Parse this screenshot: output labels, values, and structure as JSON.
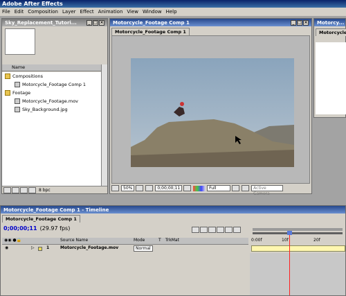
{
  "app": {
    "title": "Adobe After Effects"
  },
  "menu": [
    "File",
    "Edit",
    "Composition",
    "Layer",
    "Effect",
    "Animation",
    "View",
    "Window",
    "Help"
  ],
  "project": {
    "title": "Sky_Replacement_Tutori...",
    "col_name": "Name",
    "items": [
      {
        "label": "Compositions",
        "type": "folder",
        "indent": 0
      },
      {
        "label": "Motorcycle_Footage Comp 1",
        "type": "comp",
        "indent": 1
      },
      {
        "label": "Footage",
        "type": "folder",
        "indent": 0
      },
      {
        "label": "Motorcycle_Footage.mov",
        "type": "footage",
        "indent": 1
      },
      {
        "label": "Sky_Background.jpg",
        "type": "footage",
        "indent": 1
      }
    ],
    "bpc": "8 bpc"
  },
  "comp": {
    "title": "Motorcycle_Footage Comp 1",
    "tab": "Motorcycle_Footage Comp 1",
    "zoom": "50%",
    "timecode": "0;00;00;11",
    "resolution": "Full",
    "camera": "Active Camera"
  },
  "right_panel": {
    "title": "Motorcy...",
    "tab": "Motorcycle..."
  },
  "timeline": {
    "title": "Motorcycle_Footage Comp 1 - Timeline",
    "tab": "Motorcycle_Footage Comp 1",
    "timecode": "0;00;00;11",
    "fps": "(29.97 fps)",
    "columns": {
      "source": "Source Name",
      "mode": "Mode",
      "t": "T",
      "trkmat": "TrkMat"
    },
    "ruler": [
      "0:00f",
      "10f",
      "20f"
    ],
    "layer": {
      "num": "1",
      "name": "Motorcycle_Footage.mov",
      "mode": "Normal"
    }
  },
  "colors": {
    "accent": "#0a246a",
    "playhead": "#ff2020",
    "bar": "#fff7b0"
  }
}
